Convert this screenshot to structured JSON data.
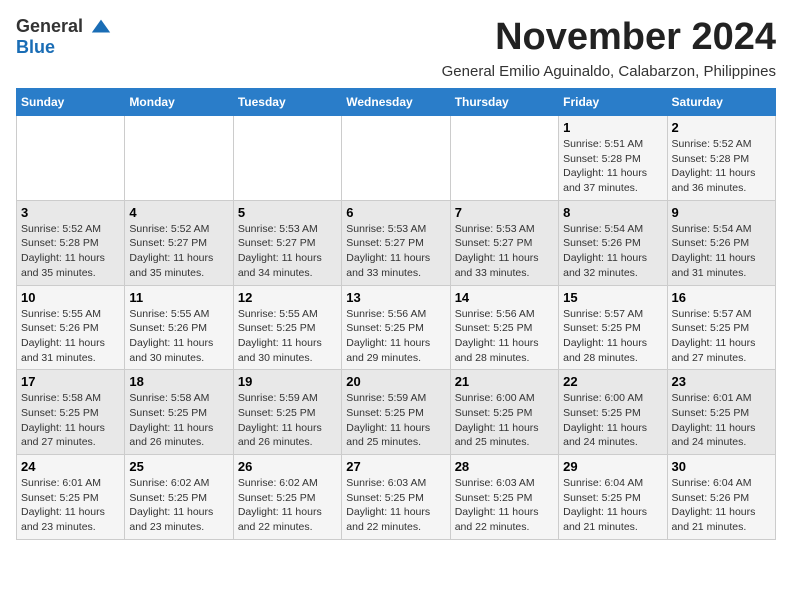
{
  "logo": {
    "general": "General",
    "blue": "Blue"
  },
  "header": {
    "month_title": "November 2024",
    "subtitle": "General Emilio Aguinaldo, Calabarzon, Philippines"
  },
  "days_of_week": [
    "Sunday",
    "Monday",
    "Tuesday",
    "Wednesday",
    "Thursday",
    "Friday",
    "Saturday"
  ],
  "weeks": [
    [
      {
        "day": "",
        "info": ""
      },
      {
        "day": "",
        "info": ""
      },
      {
        "day": "",
        "info": ""
      },
      {
        "day": "",
        "info": ""
      },
      {
        "day": "",
        "info": ""
      },
      {
        "day": "1",
        "info": "Sunrise: 5:51 AM\nSunset: 5:28 PM\nDaylight: 11 hours\nand 37 minutes."
      },
      {
        "day": "2",
        "info": "Sunrise: 5:52 AM\nSunset: 5:28 PM\nDaylight: 11 hours\nand 36 minutes."
      }
    ],
    [
      {
        "day": "3",
        "info": "Sunrise: 5:52 AM\nSunset: 5:28 PM\nDaylight: 11 hours\nand 35 minutes."
      },
      {
        "day": "4",
        "info": "Sunrise: 5:52 AM\nSunset: 5:27 PM\nDaylight: 11 hours\nand 35 minutes."
      },
      {
        "day": "5",
        "info": "Sunrise: 5:53 AM\nSunset: 5:27 PM\nDaylight: 11 hours\nand 34 minutes."
      },
      {
        "day": "6",
        "info": "Sunrise: 5:53 AM\nSunset: 5:27 PM\nDaylight: 11 hours\nand 33 minutes."
      },
      {
        "day": "7",
        "info": "Sunrise: 5:53 AM\nSunset: 5:27 PM\nDaylight: 11 hours\nand 33 minutes."
      },
      {
        "day": "8",
        "info": "Sunrise: 5:54 AM\nSunset: 5:26 PM\nDaylight: 11 hours\nand 32 minutes."
      },
      {
        "day": "9",
        "info": "Sunrise: 5:54 AM\nSunset: 5:26 PM\nDaylight: 11 hours\nand 31 minutes."
      }
    ],
    [
      {
        "day": "10",
        "info": "Sunrise: 5:55 AM\nSunset: 5:26 PM\nDaylight: 11 hours\nand 31 minutes."
      },
      {
        "day": "11",
        "info": "Sunrise: 5:55 AM\nSunset: 5:26 PM\nDaylight: 11 hours\nand 30 minutes."
      },
      {
        "day": "12",
        "info": "Sunrise: 5:55 AM\nSunset: 5:25 PM\nDaylight: 11 hours\nand 30 minutes."
      },
      {
        "day": "13",
        "info": "Sunrise: 5:56 AM\nSunset: 5:25 PM\nDaylight: 11 hours\nand 29 minutes."
      },
      {
        "day": "14",
        "info": "Sunrise: 5:56 AM\nSunset: 5:25 PM\nDaylight: 11 hours\nand 28 minutes."
      },
      {
        "day": "15",
        "info": "Sunrise: 5:57 AM\nSunset: 5:25 PM\nDaylight: 11 hours\nand 28 minutes."
      },
      {
        "day": "16",
        "info": "Sunrise: 5:57 AM\nSunset: 5:25 PM\nDaylight: 11 hours\nand 27 minutes."
      }
    ],
    [
      {
        "day": "17",
        "info": "Sunrise: 5:58 AM\nSunset: 5:25 PM\nDaylight: 11 hours\nand 27 minutes."
      },
      {
        "day": "18",
        "info": "Sunrise: 5:58 AM\nSunset: 5:25 PM\nDaylight: 11 hours\nand 26 minutes."
      },
      {
        "day": "19",
        "info": "Sunrise: 5:59 AM\nSunset: 5:25 PM\nDaylight: 11 hours\nand 26 minutes."
      },
      {
        "day": "20",
        "info": "Sunrise: 5:59 AM\nSunset: 5:25 PM\nDaylight: 11 hours\nand 25 minutes."
      },
      {
        "day": "21",
        "info": "Sunrise: 6:00 AM\nSunset: 5:25 PM\nDaylight: 11 hours\nand 25 minutes."
      },
      {
        "day": "22",
        "info": "Sunrise: 6:00 AM\nSunset: 5:25 PM\nDaylight: 11 hours\nand 24 minutes."
      },
      {
        "day": "23",
        "info": "Sunrise: 6:01 AM\nSunset: 5:25 PM\nDaylight: 11 hours\nand 24 minutes."
      }
    ],
    [
      {
        "day": "24",
        "info": "Sunrise: 6:01 AM\nSunset: 5:25 PM\nDaylight: 11 hours\nand 23 minutes."
      },
      {
        "day": "25",
        "info": "Sunrise: 6:02 AM\nSunset: 5:25 PM\nDaylight: 11 hours\nand 23 minutes."
      },
      {
        "day": "26",
        "info": "Sunrise: 6:02 AM\nSunset: 5:25 PM\nDaylight: 11 hours\nand 22 minutes."
      },
      {
        "day": "27",
        "info": "Sunrise: 6:03 AM\nSunset: 5:25 PM\nDaylight: 11 hours\nand 22 minutes."
      },
      {
        "day": "28",
        "info": "Sunrise: 6:03 AM\nSunset: 5:25 PM\nDaylight: 11 hours\nand 22 minutes."
      },
      {
        "day": "29",
        "info": "Sunrise: 6:04 AM\nSunset: 5:25 PM\nDaylight: 11 hours\nand 21 minutes."
      },
      {
        "day": "30",
        "info": "Sunrise: 6:04 AM\nSunset: 5:26 PM\nDaylight: 11 hours\nand 21 minutes."
      }
    ]
  ]
}
